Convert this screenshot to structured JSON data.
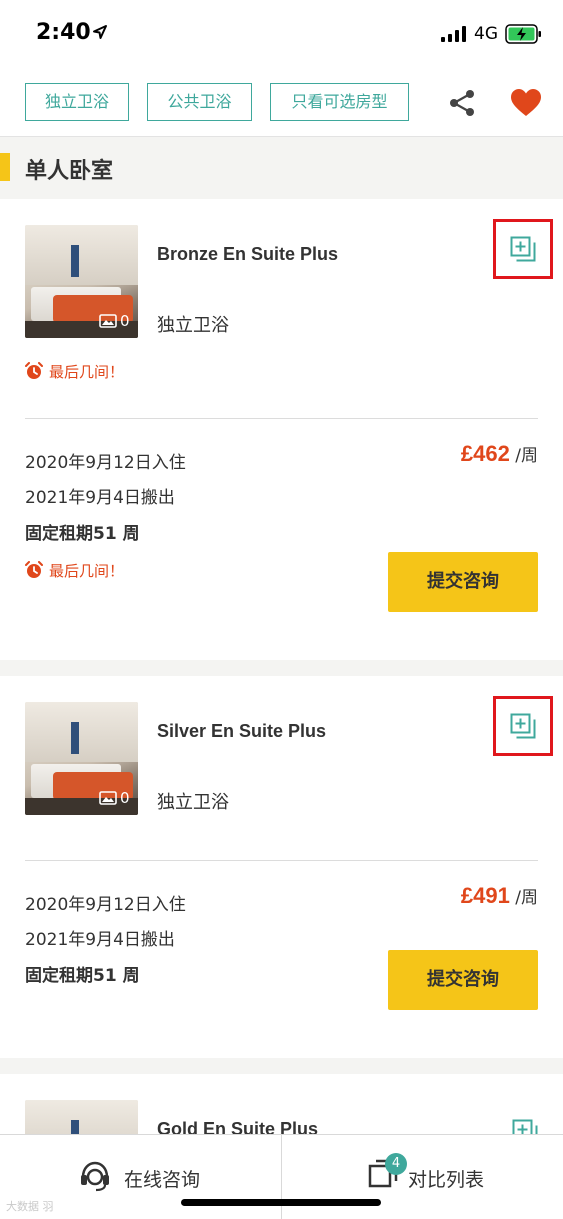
{
  "status": {
    "time": "2:40",
    "network": "4G"
  },
  "filters": {
    "chips": [
      "独立卫浴",
      "公共卫浴",
      "只看可选房型"
    ]
  },
  "icons": {
    "share": "share-icon",
    "favorite": "heart-icon",
    "compare": "compare-add-icon",
    "alarm": "alarm-clock-icon",
    "image": "image-icon",
    "consult": "headset-icon"
  },
  "colors": {
    "accent": "#3fa89c",
    "yellow": "#f5c518",
    "price": "#e0471b",
    "highlight": "#e0171c"
  },
  "section": {
    "title": "单人卧室"
  },
  "rooms": [
    {
      "name": "Bronze En Suite Plus",
      "bathroom": "独立卫浴",
      "photo_count": "0",
      "alert": "最后几间！",
      "price": "£462",
      "price_unit": "/周",
      "move_in": "2020年9月12日入住",
      "move_out": "2021年9月4日搬出",
      "lease": "固定租期51 周",
      "alert2": "最后几间！",
      "cta": "提交咨询"
    },
    {
      "name": "Silver En Suite Plus",
      "bathroom": "独立卫浴",
      "photo_count": "0",
      "price": "£491",
      "price_unit": "/周",
      "move_in": "2020年9月12日入住",
      "move_out": "2021年9月4日搬出",
      "lease": "固定租期51 周",
      "cta": "提交咨询"
    },
    {
      "name": "Gold En Suite Plus"
    }
  ],
  "bottom": {
    "consult": "在线咨询",
    "compare": "对比列表",
    "compare_count": "4"
  },
  "watermark": "大数据 羽"
}
